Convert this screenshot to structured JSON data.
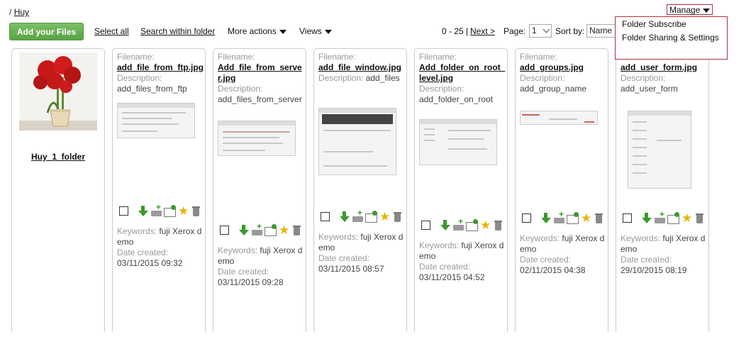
{
  "breadcrumb": {
    "sep": "/",
    "link": "Huy"
  },
  "toolbar": {
    "add_files": "Add your Files",
    "select_all": "Select all",
    "search_within": "Search within folder",
    "more_actions": "More actions",
    "views": "Views",
    "range": "0 - 25 |",
    "next": "Next >",
    "page_label": "Page:",
    "page_value": "1",
    "sort_label": "Sort by:",
    "sort_value": "Name"
  },
  "manage": {
    "label": "Manage",
    "items": [
      "Folder Subscribe",
      "Folder Sharing & Settings"
    ]
  },
  "folder": {
    "name": "Huy_1_folder"
  },
  "labels": {
    "filename": "Filename:",
    "description": "Description:",
    "keywords": "Keywords:",
    "date_created": "Date created:"
  },
  "files": [
    {
      "filename": "add_file_from_ftp.jpg",
      "description": "add_files_from_ftp",
      "keywords": "fuji Xerox demo",
      "date": "03/11/2015 09:32"
    },
    {
      "filename": "Add_file_from_server.jpg",
      "description": "add_files_from_server",
      "keywords": "fuji Xerox demo",
      "date": "03/11/2015 09:28"
    },
    {
      "filename": "add_file_window.jpg",
      "description": "add_files",
      "keywords": "fuji Xerox demo",
      "date": "03/11/2015 08:57"
    },
    {
      "filename": "Add_folder_on_root_level.jpg",
      "description": "add_folder_on_root",
      "keywords": "fuji Xerox demo",
      "date": "03/11/2015 04:52"
    },
    {
      "filename": "add_groups.jpg",
      "description": "add_group_name",
      "keywords": "fuji Xerox demo",
      "date": "02/11/2015 04:38"
    },
    {
      "filename": "add_user_form.jpg",
      "description": "add_user_form",
      "keywords": "fuji Xerox demo",
      "date": "29/10/2015 08:19"
    }
  ],
  "colors": {
    "add_button": "#5aa346",
    "manage_border": "#b03040",
    "star": "#e8b400"
  }
}
